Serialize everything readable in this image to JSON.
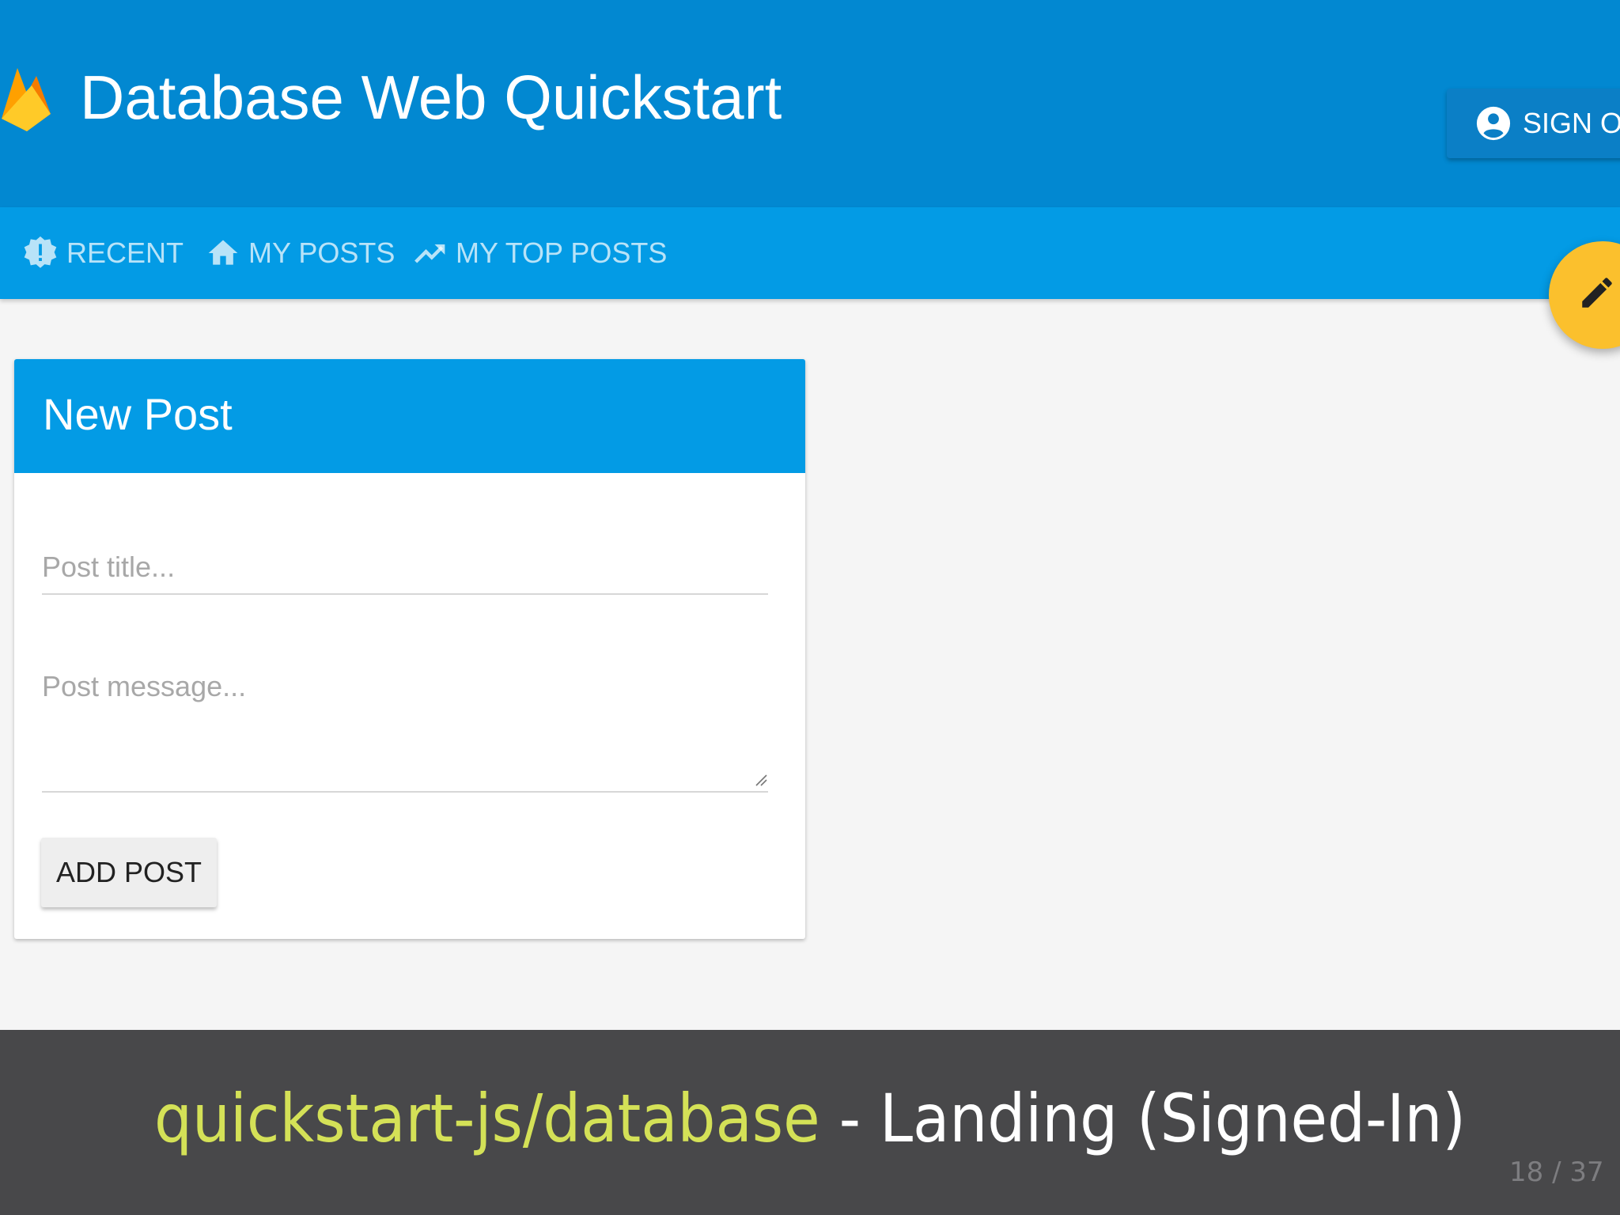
{
  "header": {
    "app_title": "Database Web Quickstart",
    "signout_label": "SIGN OUT",
    "primary_color": "#0288d1",
    "logo_icon": "firebase-flame-icon"
  },
  "tabs": [
    {
      "label": "RECENT",
      "icon": "new-releases-icon"
    },
    {
      "label": "MY POSTS",
      "icon": "home-icon"
    },
    {
      "label": "MY TOP POSTS",
      "icon": "trending-up-icon"
    }
  ],
  "fab": {
    "icon": "edit-pencil-icon",
    "color": "#fbc02d"
  },
  "new_post": {
    "title": "New Post",
    "title_placeholder": "Post title...",
    "message_placeholder": "Post message...",
    "add_label": "ADD POST",
    "header_color": "#039be5"
  },
  "caption": {
    "repo": "quickstart-js/database",
    "separator": " - ",
    "text": "Landing (Signed-In)",
    "page_counter": "18 / 37",
    "repo_color": "#d4e157"
  }
}
